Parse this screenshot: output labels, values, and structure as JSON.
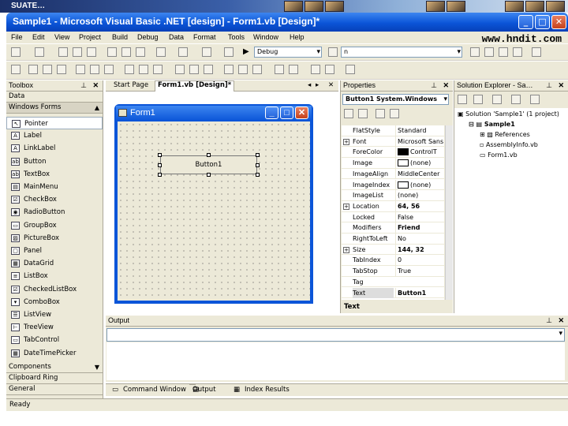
{
  "slide": {
    "banner_text": "SUATE…",
    "watermark": "www.hndit.com"
  },
  "window": {
    "title": "Sample1 - Microsoft Visual Basic .NET [design] - Form1.vb [Design]*",
    "minimize": "_",
    "maximize": "□",
    "close": "✕"
  },
  "menu": [
    "File",
    "Edit",
    "View",
    "Project",
    "Build",
    "Debug",
    "Data",
    "Format",
    "Tools",
    "Window",
    "Help"
  ],
  "toolbar": {
    "config_combo": "Debug",
    "find_combo": "n"
  },
  "toolbox": {
    "title": "Toolbox",
    "sections_top": [
      "Data",
      "Windows Forms"
    ],
    "items": [
      {
        "label": "Pointer",
        "icon": "pointer-icon"
      },
      {
        "label": "Label",
        "icon": "label-icon"
      },
      {
        "label": "LinkLabel",
        "icon": "linklabel-icon"
      },
      {
        "label": "Button",
        "icon": "button-icon"
      },
      {
        "label": "TextBox",
        "icon": "textbox-icon"
      },
      {
        "label": "MainMenu",
        "icon": "mainmenu-icon"
      },
      {
        "label": "CheckBox",
        "icon": "checkbox-icon"
      },
      {
        "label": "RadioButton",
        "icon": "radiobutton-icon"
      },
      {
        "label": "GroupBox",
        "icon": "groupbox-icon"
      },
      {
        "label": "PictureBox",
        "icon": "picturebox-icon"
      },
      {
        "label": "Panel",
        "icon": "panel-icon"
      },
      {
        "label": "DataGrid",
        "icon": "datagrid-icon"
      },
      {
        "label": "ListBox",
        "icon": "listbox-icon"
      },
      {
        "label": "CheckedListBox",
        "icon": "checkedlistbox-icon"
      },
      {
        "label": "ComboBox",
        "icon": "combobox-icon"
      },
      {
        "label": "ListView",
        "icon": "listview-icon"
      },
      {
        "label": "TreeView",
        "icon": "treeview-icon"
      },
      {
        "label": "TabControl",
        "icon": "tabcontrol-icon"
      },
      {
        "label": "DateTimePicker",
        "icon": "datetimepicker-icon"
      }
    ],
    "sections_bottom": [
      "Components",
      "Clipboard Ring",
      "General"
    ]
  },
  "document": {
    "tabs": [
      "Start Page",
      "Form1.vb [Design]*"
    ],
    "form_title": "Form1",
    "button_label": "Button1"
  },
  "properties": {
    "title": "Properties",
    "object_combo": "Button1  System.Windows",
    "rows": [
      {
        "name": "FlatStyle",
        "value": "Standard",
        "plus": false,
        "bold": false
      },
      {
        "name": "Font",
        "value": "Microsoft Sans",
        "plus": true,
        "bold": false
      },
      {
        "name": "ForeColor",
        "value": "ControlT",
        "plus": false,
        "bold": false,
        "swatch": "#000000"
      },
      {
        "name": "Image",
        "value": "(none)",
        "plus": false,
        "bold": false,
        "swatch": "#ffffff"
      },
      {
        "name": "ImageAlign",
        "value": "MiddleCenter",
        "plus": false,
        "bold": false
      },
      {
        "name": "ImageIndex",
        "value": "(none)",
        "plus": false,
        "bold": false,
        "swatch": "#ffffff"
      },
      {
        "name": "ImageList",
        "value": "(none)",
        "plus": false,
        "bold": false
      },
      {
        "name": "Location",
        "value": "64, 56",
        "plus": true,
        "bold": true
      },
      {
        "name": "Locked",
        "value": "False",
        "plus": false,
        "bold": false
      },
      {
        "name": "Modifiers",
        "value": "Friend",
        "plus": false,
        "bold": true
      },
      {
        "name": "RightToLeft",
        "value": "No",
        "plus": false,
        "bold": false
      },
      {
        "name": "Size",
        "value": "144, 32",
        "plus": true,
        "bold": true
      },
      {
        "name": "TabIndex",
        "value": "0",
        "plus": false,
        "bold": false
      },
      {
        "name": "TabStop",
        "value": "True",
        "plus": false,
        "bold": false
      },
      {
        "name": "Tag",
        "value": "",
        "plus": false,
        "bold": false
      },
      {
        "name": "Text",
        "value": "Button1",
        "plus": false,
        "bold": true,
        "selected": true
      }
    ],
    "footer": "Text"
  },
  "solution_explorer": {
    "title": "Solution Explorer - Sa…",
    "tree": [
      {
        "label": "Solution 'Sample1' (1 project)",
        "indent": 0,
        "icon": "solution-icon"
      },
      {
        "label": "Sample1",
        "indent": 1,
        "icon": "project-icon",
        "bold": true
      },
      {
        "label": "References",
        "indent": 2,
        "icon": "references-icon"
      },
      {
        "label": "AssemblyInfo.vb",
        "indent": 2,
        "icon": "vbfile-icon"
      },
      {
        "label": "Form1.vb",
        "indent": 2,
        "icon": "form-file-icon"
      }
    ]
  },
  "output": {
    "title": "Output"
  },
  "bottom_tabs": [
    "Command Window",
    "Output",
    "Index Results"
  ],
  "status": {
    "text": "Ready"
  }
}
